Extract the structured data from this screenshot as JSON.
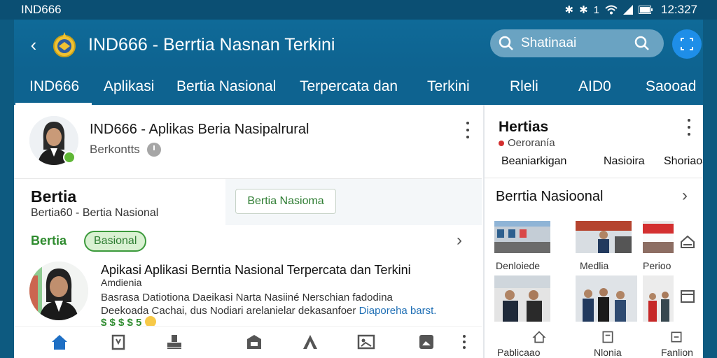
{
  "status": {
    "carrier": "IND666",
    "time": "12:327"
  },
  "appbar": {
    "title": "IND666 - Berrtia Nasnan Terkini"
  },
  "search": {
    "placeholder": "Shatinaai"
  },
  "tabs": [
    {
      "label": "IND666",
      "active": true
    },
    {
      "label": "Aplikasi"
    },
    {
      "label": "Bertia Nasional"
    },
    {
      "label": "Terpercata dan"
    },
    {
      "label": "Terkini"
    },
    {
      "label": "Rleli"
    },
    {
      "label": "AID0"
    },
    {
      "label": "Saooad"
    }
  ],
  "post": {
    "title": "IND666 - Aplikas Beria Nasipalrural",
    "subtitle": "Berkontts"
  },
  "section1": {
    "title": "Bertia",
    "subtitle": "Bertia60 - Bertia Nasional",
    "button_label": "Bertia Nasioma"
  },
  "section2": {
    "title": "Bertia",
    "badge": "Basional"
  },
  "article": {
    "title": "Apikasi  Aplikasi Berntia Nasional Terpercata dan Terkini",
    "subtitle": "Amdienia",
    "body_line1": "Basrasa Datiotiona Daeikasi Narta Nasiiné Nerschian fadodina",
    "body_line2": "Deekoada Cachai, dus Nodiari arelanielar dekasanfoer",
    "body_link": "Diaporeha barst.",
    "footer": "$ $ $ $ 5"
  },
  "right": {
    "title": "Hertias",
    "subtitle": "Oeroranía",
    "tabs": [
      "Beaniarkigan",
      "Nasioira",
      "Shoriaoa"
    ],
    "section_title": "Berrtia Nasioonal",
    "thumb_labels_row1": [
      "Denloiede",
      "Medlia",
      "Perioo"
    ],
    "thumb_labels_row2": [
      "Pablicaao",
      "Nlonia",
      "Fanlion"
    ]
  },
  "colors": {
    "appbar": "#0e6390",
    "accent": "#1e8ee8",
    "green": "#2e8b2e"
  }
}
